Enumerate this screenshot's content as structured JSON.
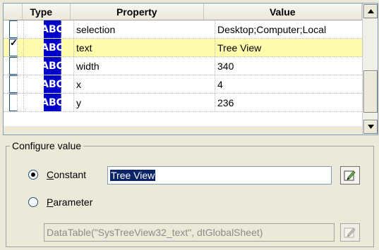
{
  "grid": {
    "columns": [
      "Type",
      "Property",
      "Value"
    ],
    "rows": [
      {
        "checked": false,
        "type": "ABC",
        "property": "selection",
        "value": "Desktop;Computer;Local",
        "selected": false
      },
      {
        "checked": true,
        "type": "ABC",
        "property": "text",
        "value": "Tree View",
        "selected": true
      },
      {
        "checked": false,
        "type": "ABC",
        "property": "width",
        "value": "340",
        "selected": false
      },
      {
        "checked": false,
        "type": "ABC",
        "property": "x",
        "value": "4",
        "selected": false
      },
      {
        "checked": false,
        "type": "ABC",
        "property": "y",
        "value": "236",
        "selected": false
      }
    ]
  },
  "configure": {
    "title": "Configure value",
    "constant_label_underlined": "C",
    "constant_label_rest": "onstant",
    "parameter_label_underlined": "P",
    "parameter_label_rest": "arameter",
    "constant_value": "Tree View",
    "parameter_value": "DataTable(\"SysTreeView32_text\", dtGlobalSheet)",
    "selected_option": "constant"
  },
  "icons": {
    "type_badge": "abc-string-icon",
    "edit": "pencil-edit-icon"
  },
  "colors": {
    "selected_row": "#fffcac",
    "badge": "#0000c8",
    "selection_highlight": "#0a246a"
  }
}
